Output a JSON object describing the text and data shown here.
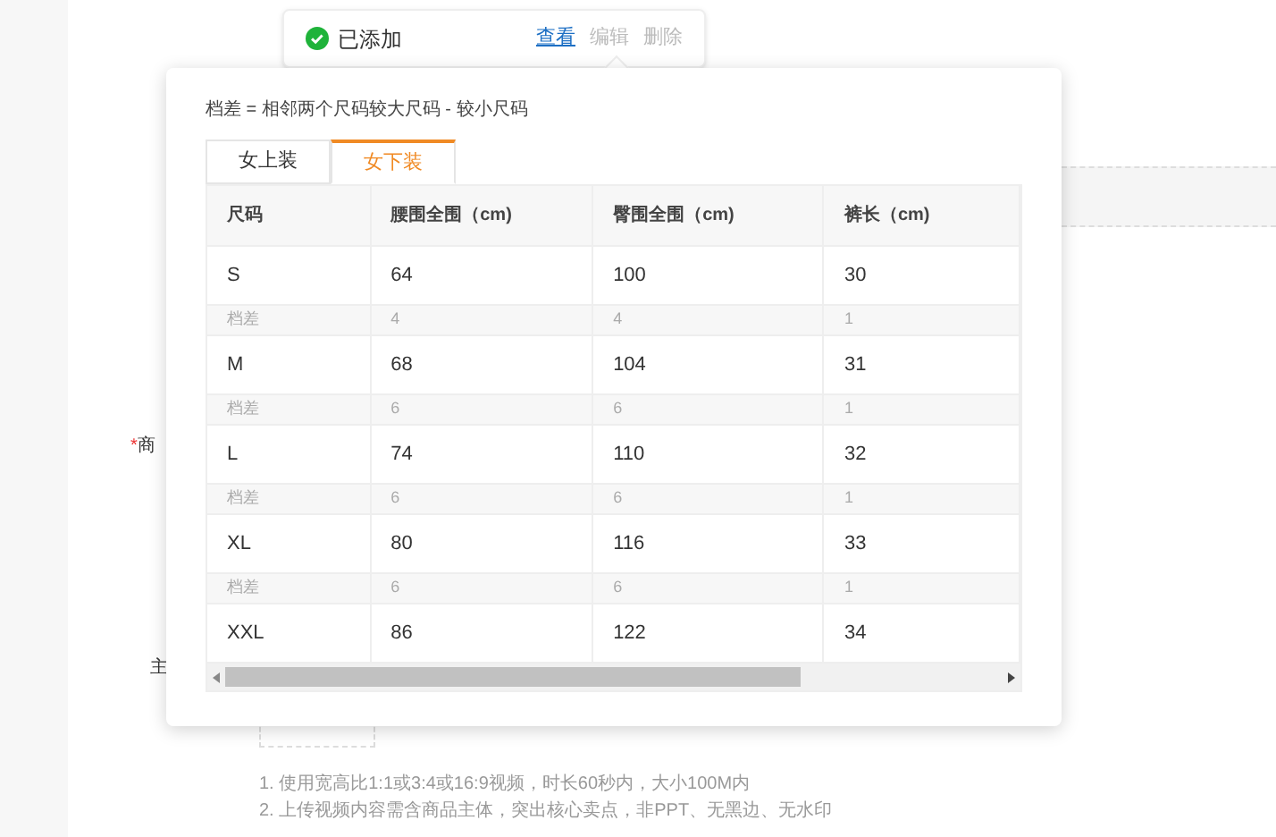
{
  "status_card": {
    "status": "已添加",
    "actions": [
      {
        "label": "查看",
        "selected": true
      },
      {
        "label": "编辑",
        "selected": false
      },
      {
        "label": "删除",
        "selected": false
      }
    ]
  },
  "background_labels": [
    {
      "mark": "*",
      "text": "商"
    },
    {
      "text": "主"
    }
  ],
  "popover": {
    "note": "档差 = 相邻两个尺码较大尺码 - 较小尺码",
    "tabs": [
      {
        "label": "女上装",
        "selected": false
      },
      {
        "label": "女下装",
        "selected": true
      }
    ],
    "table": {
      "columns": [
        "尺码",
        "腰围全围（cm)",
        "臀围全围（cm)",
        "裤长（cm)"
      ],
      "rows": [
        {
          "kind": "size",
          "cells": [
            "S",
            "64",
            "100",
            "30"
          ]
        },
        {
          "kind": "diff",
          "cells": [
            "档差",
            "4",
            "4",
            "1"
          ]
        },
        {
          "kind": "size",
          "cells": [
            "M",
            "68",
            "104",
            "31"
          ]
        },
        {
          "kind": "diff",
          "cells": [
            "档差",
            "6",
            "6",
            "1"
          ]
        },
        {
          "kind": "size",
          "cells": [
            "L",
            "74",
            "110",
            "32"
          ]
        },
        {
          "kind": "diff",
          "cells": [
            "档差",
            "6",
            "6",
            "1"
          ]
        },
        {
          "kind": "size",
          "cells": [
            "XL",
            "80",
            "116",
            "33"
          ]
        },
        {
          "kind": "diff",
          "cells": [
            "档差",
            "6",
            "6",
            "1"
          ]
        },
        {
          "kind": "size",
          "cells": [
            "XXL",
            "86",
            "122",
            "34"
          ]
        }
      ]
    }
  },
  "instructions": [
    "1. 使用宽高比1:1或3:4或16:9视频，时长60秒内，大小100M内",
    "2. 上传视频内容需含商品主体，突出核心卖点，非PPT、无黑边、无水印"
  ]
}
